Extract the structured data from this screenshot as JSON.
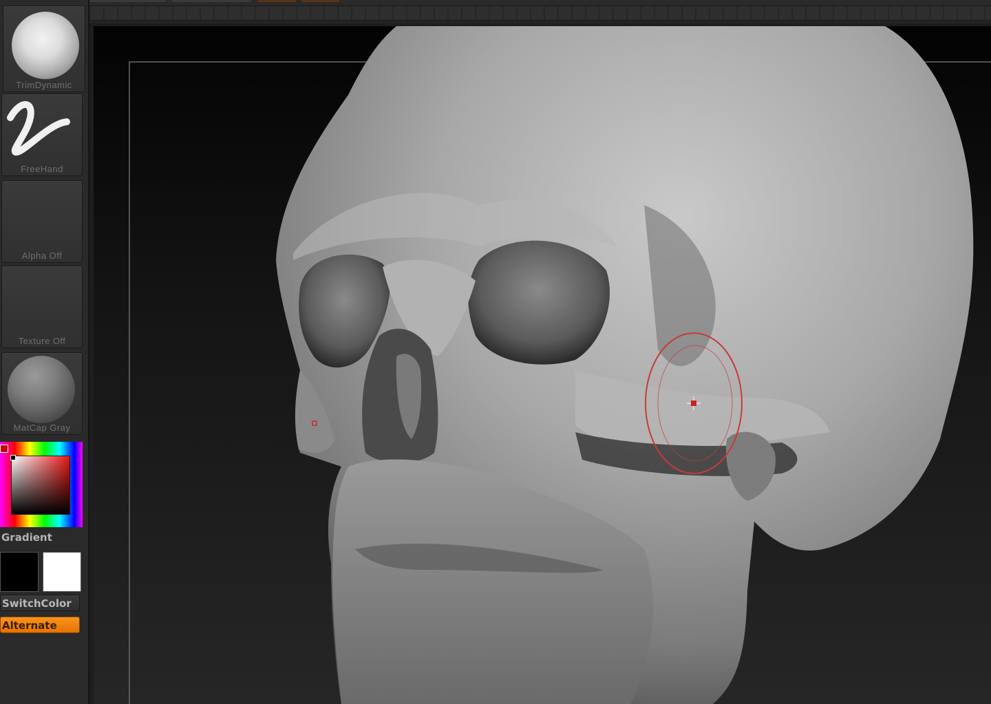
{
  "tray": {
    "brush_label": "TrimDynamic",
    "stroke_label": "FreeHand",
    "alpha_label": "Alpha  Off",
    "texture_label": "Texture  Off",
    "material_label": "MatCap  Gray",
    "gradient_label": "Gradient",
    "switch_label": "SwitchColor",
    "alternate_label": "Alternate",
    "main_color": "#000000",
    "secondary_color": "#ffffff",
    "accent": "#f7941e"
  },
  "icons": {
    "stroke": "freehand-stroke-icon",
    "brush": "brush-sphere-icon",
    "material": "matcap-sphere-icon",
    "cursor": "brush-cursor-icon"
  }
}
